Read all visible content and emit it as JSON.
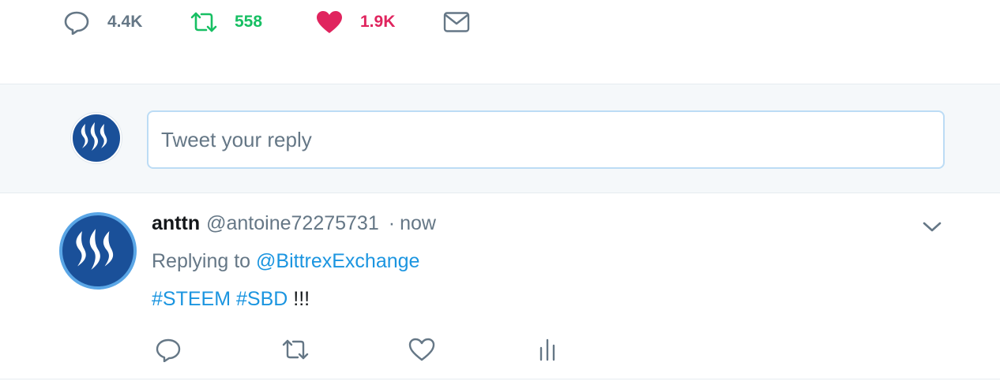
{
  "top_actions": {
    "reply_count": "4.4K",
    "retweet_count": "558",
    "like_count": "1.9K",
    "icons": [
      "reply-icon",
      "retweet-icon",
      "heart-icon",
      "envelope-icon"
    ],
    "colors": {
      "reply": "#657786",
      "retweet": "#17bf63",
      "like": "#e0245e"
    }
  },
  "reply_box": {
    "placeholder": "Tweet your reply",
    "avatar_icon": "steem-logo"
  },
  "tweet": {
    "name": "anttn",
    "handle": "@antoine72275731",
    "separator": "·",
    "time": "now",
    "replying_prefix": "Replying to",
    "replying_to": "@BittrexExchange",
    "hashtags": [
      "#STEEM",
      "#SBD"
    ],
    "text_suffix": "!!!",
    "avatar_icon": "steem-logo",
    "menu_icon": "chevron-down-icon",
    "action_icons": [
      "reply-icon",
      "retweet-icon",
      "heart-icon",
      "analytics-icon"
    ],
    "link_color": "#1b95e0"
  }
}
